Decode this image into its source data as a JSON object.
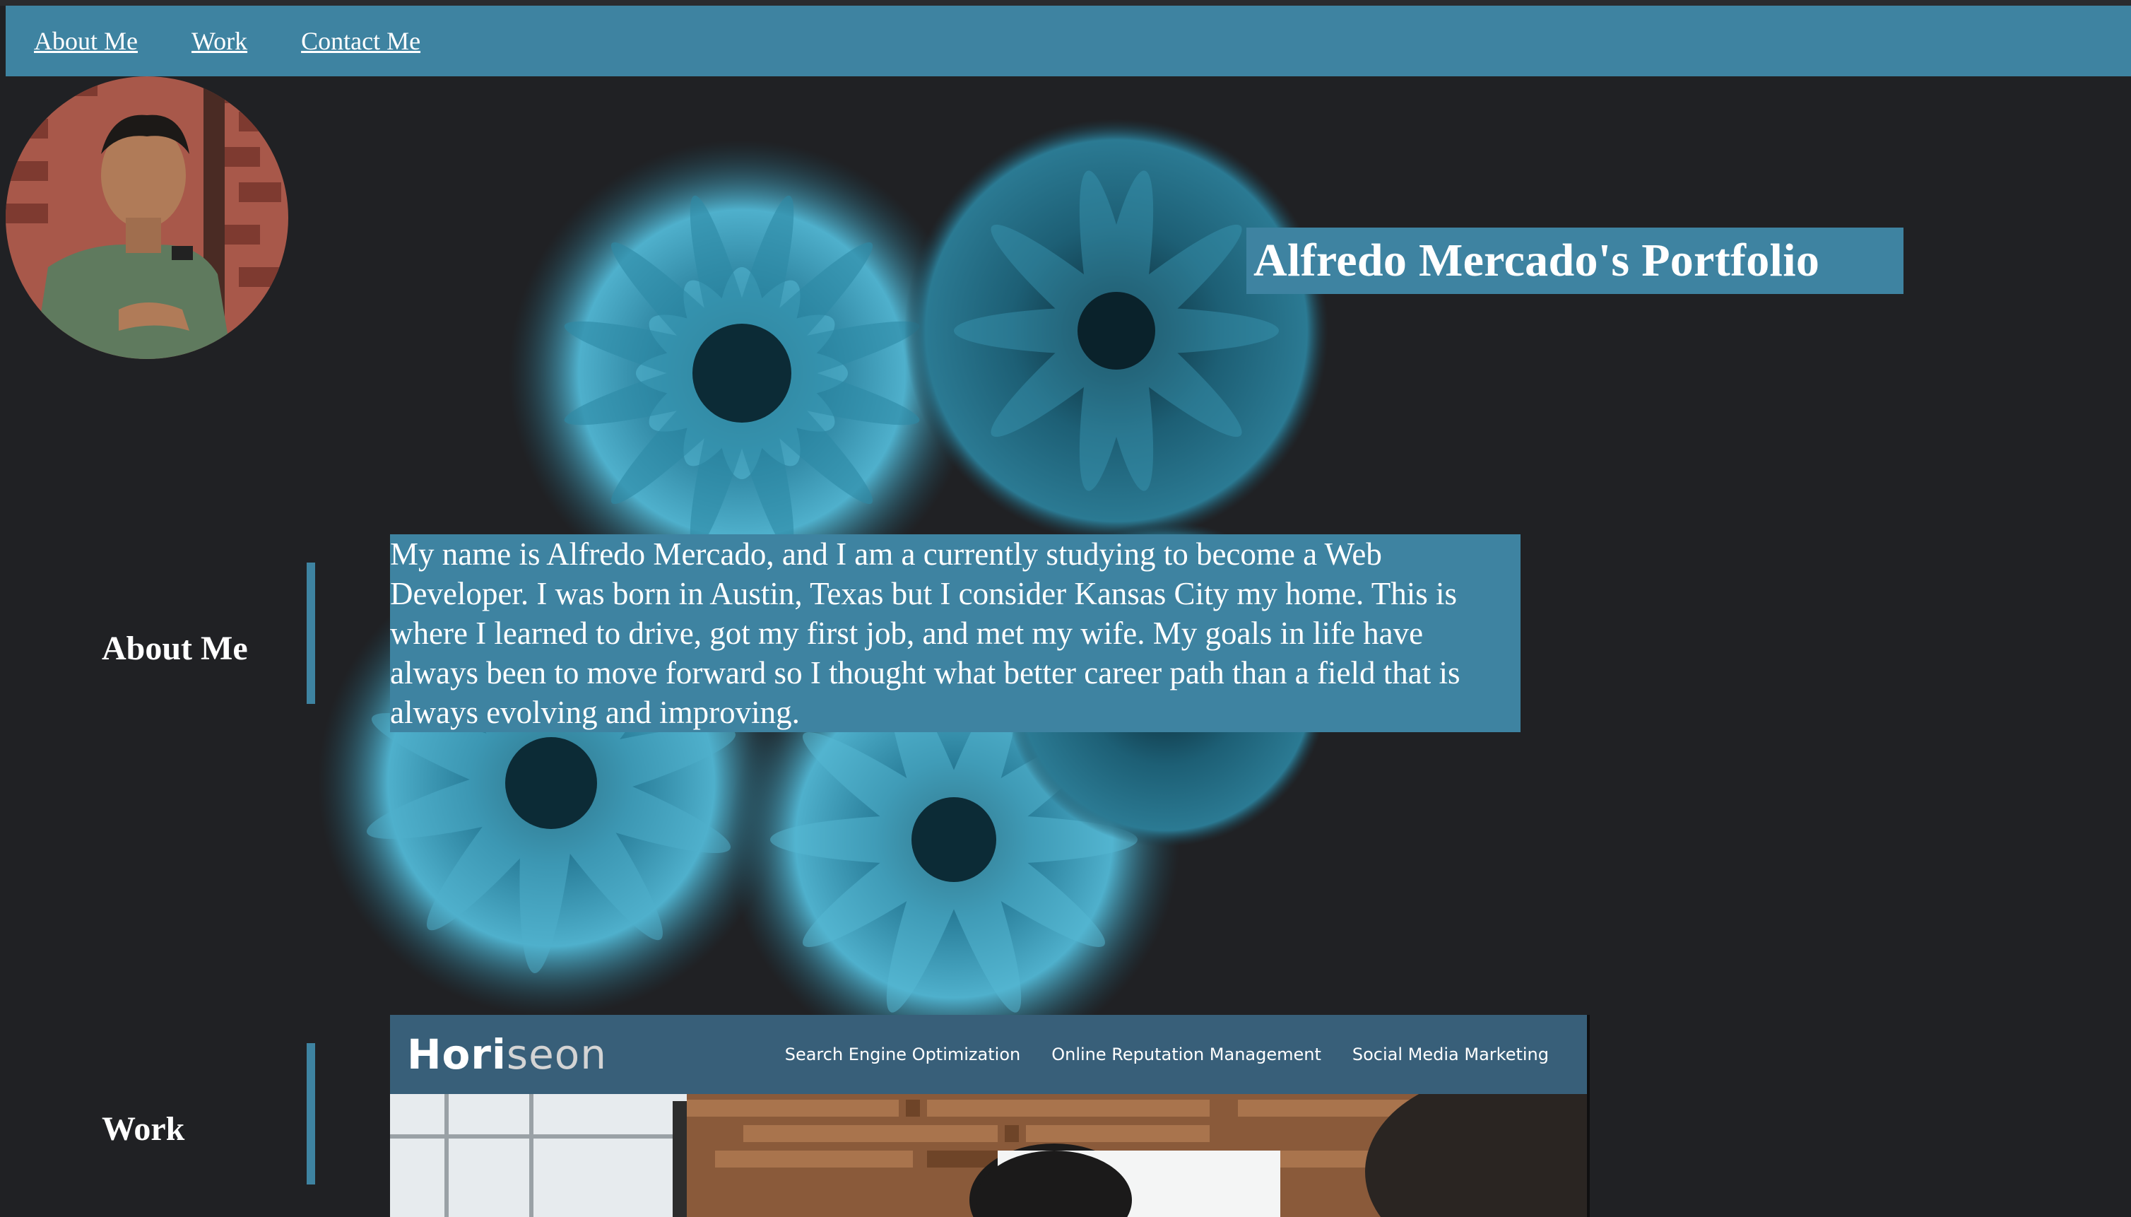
{
  "nav": {
    "items": [
      "About Me",
      "Work",
      "Contact Me"
    ]
  },
  "header": {
    "title": "Alfredo Mercado's Portfolio"
  },
  "about": {
    "heading": "About Me",
    "body": "My name is Alfredo Mercado, and I am a currently studying to become a Web Developer. I was born in Austin, Texas but I consider Kansas City my home. This is where I learned to drive, got my first job, and met my wife. My goals in life have always been to move forward so I thought what better career path than a field that is always evolving and improving."
  },
  "work": {
    "heading": "Work",
    "project": {
      "logo_main": "Hori",
      "logo_accent": "seon",
      "nav": [
        "Search Engine Optimization",
        "Online Reputation Management",
        "Social Media Marketing"
      ]
    }
  },
  "colors": {
    "accent": "#3e83a1",
    "background": "#202124",
    "project_header": "#385f79"
  },
  "icons": {
    "hero": "blue-chrysanthemum-flowers-image",
    "avatar": "profile-photo",
    "project": "horiseon-screenshot"
  }
}
